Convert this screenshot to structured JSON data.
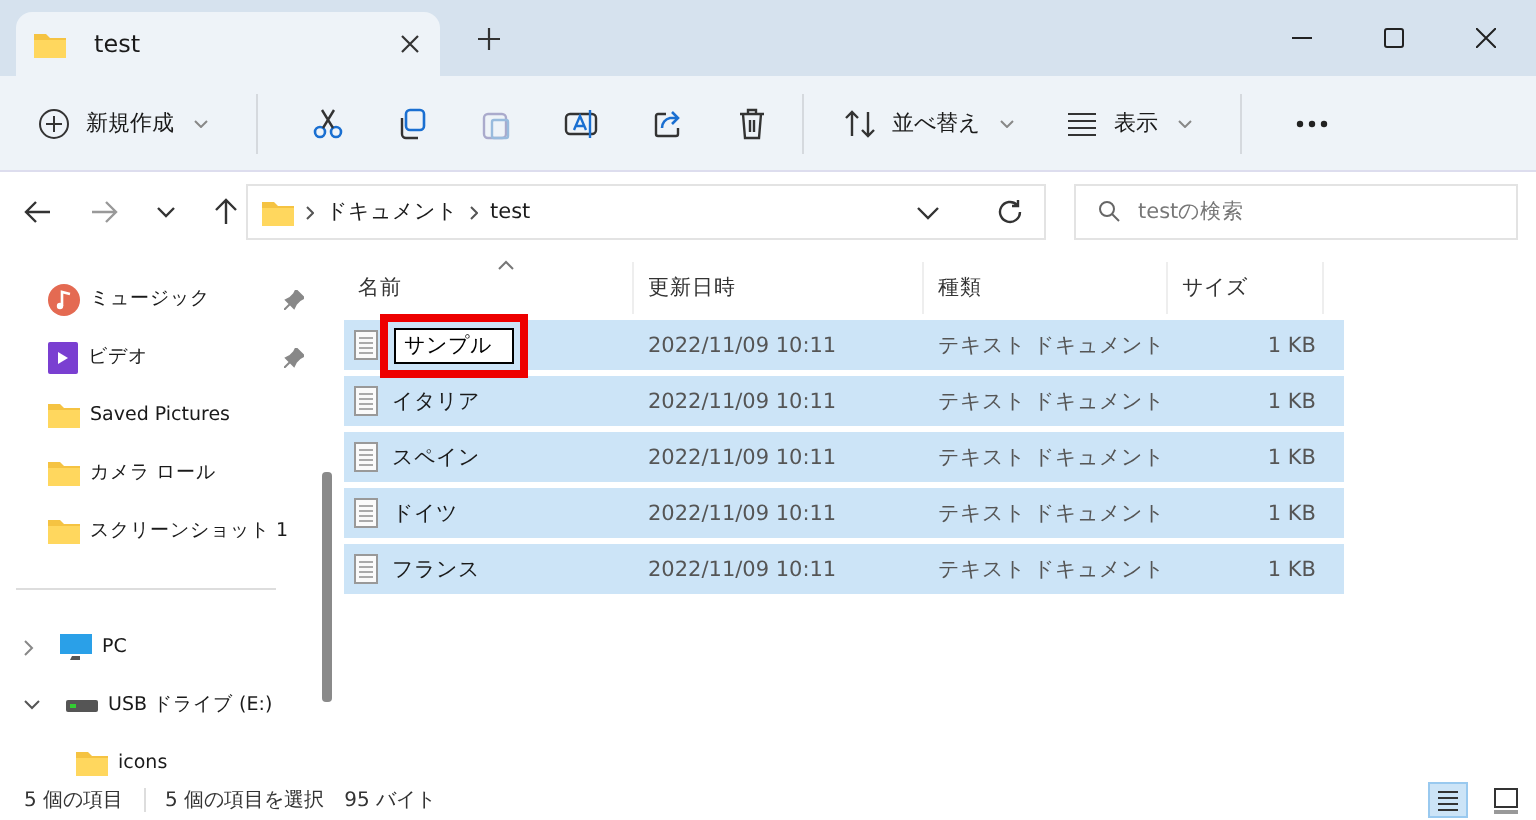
{
  "window": {
    "tab_title": "test"
  },
  "toolbar": {
    "new": "新規作成",
    "sort": "並べ替え",
    "view": "表示"
  },
  "address": {
    "path": [
      "ドキュメント",
      "test"
    ],
    "search_placeholder": "testの検索"
  },
  "sidebar": {
    "items": [
      {
        "label": "ミュージック",
        "kind": "music",
        "pinned": true
      },
      {
        "label": "ビデオ",
        "kind": "video",
        "pinned": true
      },
      {
        "label": "Saved Pictures",
        "kind": "folder",
        "pinned": false
      },
      {
        "label": "カメラ ロール",
        "kind": "folder",
        "pinned": false
      },
      {
        "label": "スクリーンショット 1",
        "kind": "folder",
        "pinned": false
      }
    ],
    "drives": [
      {
        "label": "PC",
        "kind": "pc",
        "expanded": false
      },
      {
        "label": "USB ドライブ (E:)",
        "kind": "usb",
        "expanded": true,
        "children": [
          {
            "label": "icons"
          }
        ]
      }
    ]
  },
  "table": {
    "columns": [
      "名前",
      "更新日時",
      "種類",
      "サイズ"
    ],
    "rows": [
      {
        "name": "サンプル",
        "modified": "2022/11/09 10:11",
        "type": "テキスト ドキュメント",
        "size": "1 KB",
        "selected": true,
        "renaming": true
      },
      {
        "name": "イタリア",
        "modified": "2022/11/09 10:11",
        "type": "テキスト ドキュメント",
        "size": "1 KB",
        "selected": true,
        "renaming": false
      },
      {
        "name": "スペイン",
        "modified": "2022/11/09 10:11",
        "type": "テキスト ドキュメント",
        "size": "1 KB",
        "selected": true,
        "renaming": false
      },
      {
        "name": "ドイツ",
        "modified": "2022/11/09 10:11",
        "type": "テキスト ドキュメント",
        "size": "1 KB",
        "selected": true,
        "renaming": false
      },
      {
        "name": "フランス",
        "modified": "2022/11/09 10:11",
        "type": "テキスト ドキュメント",
        "size": "1 KB",
        "selected": true,
        "renaming": false
      }
    ]
  },
  "status_bar": {
    "count": "5 個の項目",
    "selection": "5 個の項目を選択",
    "size": "95 バイト"
  }
}
